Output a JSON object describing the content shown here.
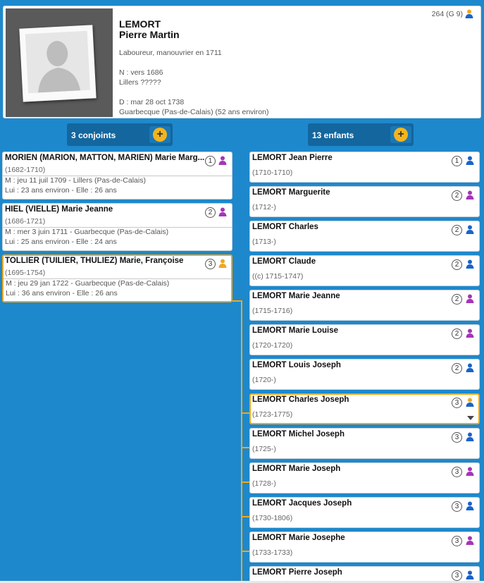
{
  "person": {
    "surname": "LEMORT",
    "given_names": "Pierre Martin",
    "occupation": "Laboureur, manouvrier en 1711",
    "birth": "N : vers 1686",
    "birth_place": "Lillers ?????",
    "death": "D : mar 28 oct 1738",
    "death_place": "Guarbecque (Pas-de-Calais) (52 ans environ)",
    "sosa": "264 (G 9)"
  },
  "spouses_tab": {
    "label": "3 conjoints",
    "add_label": "+"
  },
  "children_tab": {
    "label": "13 enfants",
    "add_label": "+"
  },
  "spouses": [
    {
      "name": "MORIEN (MARION, MATTON, MARIEN) Marie Marg...",
      "years": "(1682-1710)",
      "marriage": "M : jeu 11 juil 1709 - Lillers (Pas-de-Calais)",
      "ages": "Lui : 23 ans environ - Elle : 26 ans",
      "badge": "1",
      "sex": "female"
    },
    {
      "name": "HIEL (VIELLE) Marie Jeanne",
      "years": "(1686-1721)",
      "marriage": "M : mer 3 juin 1711 - Guarbecque (Pas-de-Calais)",
      "ages": "Lui : 25 ans environ - Elle : 24 ans",
      "badge": "2",
      "sex": "female"
    },
    {
      "name": "TOLLIER (TUILIER, THULIEZ) Marie, Françoise",
      "years": "(1695-1754)",
      "marriage": "M : jeu 29 jan 1722 - Guarbecque (Pas-de-Calais)",
      "ages": "Lui : 36 ans environ - Elle : 26 ans",
      "badge": "3",
      "sex": "female-selected"
    }
  ],
  "children": [
    {
      "name": "LEMORT Jean Pierre",
      "years": "(1710-1710)",
      "badge": "1",
      "sex": "male"
    },
    {
      "name": "LEMORT Marguerite",
      "years": "(1712-)",
      "badge": "2",
      "sex": "female"
    },
    {
      "name": "LEMORT Charles",
      "years": "(1713-)",
      "badge": "2",
      "sex": "male"
    },
    {
      "name": "LEMORT Claude",
      "years": "((c) 1715-1747)",
      "badge": "2",
      "sex": "male"
    },
    {
      "name": "LEMORT Marie Jeanne",
      "years": "(1715-1716)",
      "badge": "2",
      "sex": "female"
    },
    {
      "name": "LEMORT Marie Louise",
      "years": "(1720-1720)",
      "badge": "2",
      "sex": "female"
    },
    {
      "name": "LEMORT Louis Joseph",
      "years": "(1720-)",
      "badge": "2",
      "sex": "male"
    },
    {
      "name": "LEMORT Charles Joseph",
      "years": "(1723-1775)",
      "badge": "3",
      "sex": "male-selected"
    },
    {
      "name": "LEMORT Michel Joseph",
      "years": "(1725-)",
      "badge": "3",
      "sex": "male"
    },
    {
      "name": "LEMORT Marie Joseph",
      "years": "(1728-)",
      "badge": "3",
      "sex": "female"
    },
    {
      "name": "LEMORT Jacques Joseph",
      "years": "(1730-1806)",
      "badge": "3",
      "sex": "male"
    },
    {
      "name": "LEMORT Marie Josephe",
      "years": "(1733-1733)",
      "badge": "3",
      "sex": "female"
    },
    {
      "name": "LEMORT Pierre Joseph",
      "years": "",
      "badge": "3",
      "sex": "male"
    }
  ],
  "icons": {
    "male": "male-person-icon",
    "female": "female-person-icon",
    "selected": "selected-person-icon",
    "dropdown": "dropdown-arrow-icon"
  },
  "colors": {
    "background": "#1e88cc",
    "tab": "#13669e",
    "accent": "#f0a81c",
    "male": "#1a63c8",
    "female": "#a634b8",
    "selected": "#f0a81c"
  }
}
